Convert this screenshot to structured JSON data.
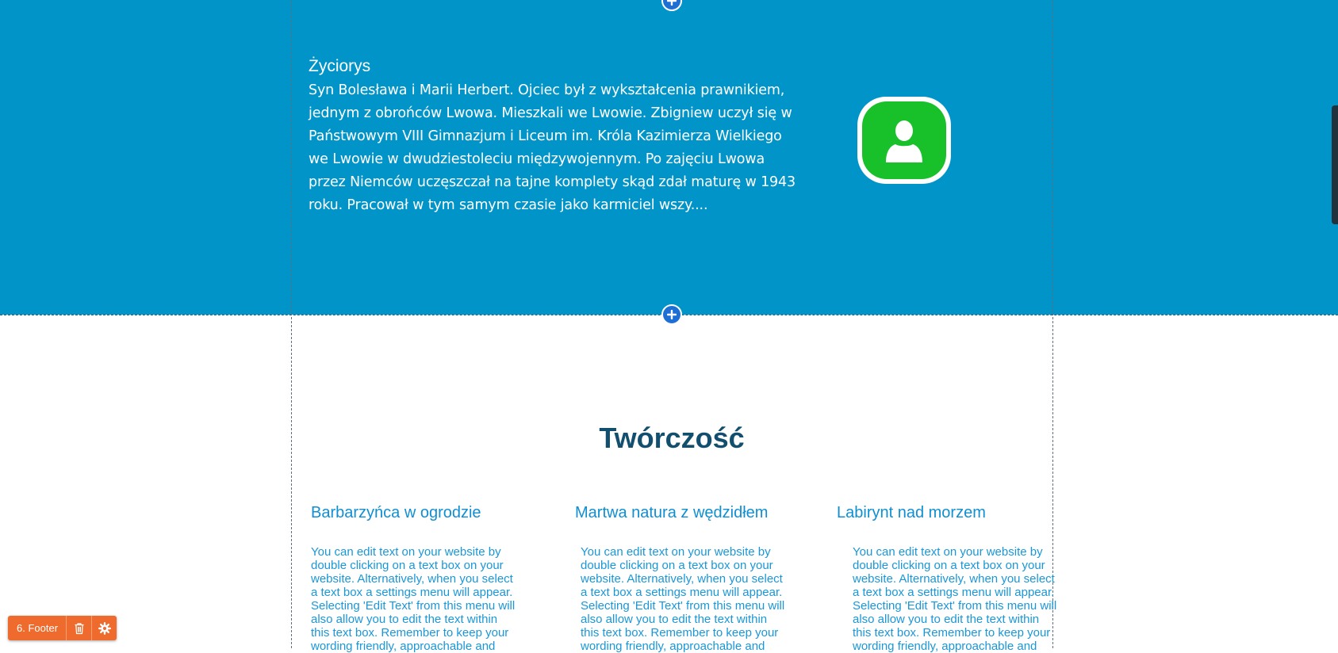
{
  "biography": {
    "title": "Życiorys",
    "text": "Syn Bolesława i Marii Herbert. Ojciec był z wykształcenia prawnikiem, jednym z obrońców Lwowa. Mieszkali we Lwowie. Zbigniew uczył się w Państwowym VIII Gimnazjum i Liceum im. Króla Kazimierza Wielkiego we Lwowie w dwudziestoleciu międzywojennym. Po zajęciu Lwowa przez Niemców uczęszczał na tajne komplety skąd zdał maturę w 1943 roku. Pracował w tym samym czasie jako karmiciel wszy....",
    "avatar_icon": "user-icon"
  },
  "works": {
    "title": "Twórczość",
    "columns": [
      {
        "title": "Barbarzyńca w ogrodzie",
        "text": "You can edit text on your website by double clicking on a text box on your website. Alternatively, when you select a text box a settings menu will appear. Selecting 'Edit Text' from this menu will also allow you to edit the text within this text box. Remember to keep your wording friendly, approachable and"
      },
      {
        "title": "Martwa natura z wędzidłem",
        "text": "You can edit text on your website by double clicking on a text box on your website. Alternatively, when you select a text box a settings menu will appear. Selecting 'Edit Text' from this menu will also allow you to edit the text within this text box. Remember to keep your wording friendly, approachable and"
      },
      {
        "title": "Labirynt nad morzem",
        "text": "You can edit text on your website by double clicking on a text box on your website. Alternatively, when you select a text box a settings menu will appear. Selecting 'Edit Text' from this menu will also allow you to edit the text within this text box. Remember to keep your wording friendly, approachable and"
      }
    ]
  },
  "editor": {
    "section_label": "6. Footer",
    "delete_icon": "trash-icon",
    "settings_icon": "gear-icon",
    "add_section_icon": "plus-icon"
  },
  "colors": {
    "section_blue": "#0194c8",
    "avatar_green": "#18c12a",
    "heading_dark_blue": "#124f6e",
    "link_blue": "#0f8fd2",
    "toolbar_orange": "#ee6b2d"
  }
}
